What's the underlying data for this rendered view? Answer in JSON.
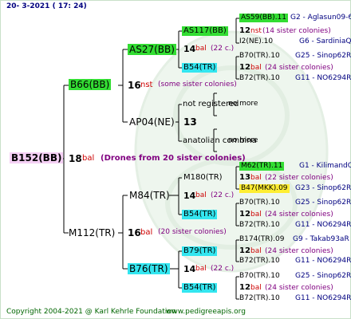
{
  "header": {
    "date": "20-  3-2021 ( 17: 24)"
  },
  "footer": {
    "copyright": "Copyright 2004-2021 @ Karl Kehrle Foundation",
    "site": "www.pedigreeapis.org"
  },
  "gen1": {
    "name": "B152(BB)",
    "num": "18",
    "bal": "bal",
    "note": "(Drones from 20 sister colonies)"
  },
  "gen2": {
    "top": {
      "name": "B66(BB)",
      "num": "16",
      "nst": "nst",
      "note": "(some sister colonies)"
    },
    "bottom": {
      "name": "M112(TR)",
      "num": "16",
      "bal": "bal",
      "note": "(20 sister colonies)"
    }
  },
  "gen3": {
    "a": {
      "name": "AS27(BB)",
      "num": "14",
      "bal": "bal",
      "note": "(22 c.)"
    },
    "b": {
      "name": "AP04(NE)",
      "num": "13"
    },
    "c": {
      "name": "M84(TR)",
      "num": "14",
      "bal": "bal",
      "note": "(22 c.)"
    },
    "d": {
      "name": "B76(TR)",
      "num": "14",
      "bal": "bal",
      "note": "(22 c.)"
    }
  },
  "gen4": {
    "a1": {
      "name": "AS117(BB)",
      "num": "12",
      "nst": "nst",
      "note": "(14 sister colonies)"
    },
    "a2": {
      "name": "B54(TR)",
      "num": "12",
      "bal": "bal",
      "note": "(24 sister colonies)"
    },
    "b1": {
      "name": "not registered"
    },
    "b2": {
      "name": "anatolian combina"
    },
    "c1": {
      "name": "M180(TR)",
      "num": "13",
      "bal": "bal",
      "note": "(22 sister colonies)"
    },
    "c2": {
      "name": "B54(TR)",
      "num": "12",
      "bal": "bal",
      "note": "(24 sister colonies)"
    },
    "d1": {
      "name": "B79(TR)",
      "num": "12",
      "bal": "bal",
      "note": "(24 sister colonies)"
    },
    "d2": {
      "name": "B54(TR)",
      "num": "12",
      "bal": "bal",
      "note": "(24 sister colonies)"
    }
  },
  "gen5": [
    {
      "name": "AS59(BB).11",
      "info": "G2 - Aglasun09-6"
    },
    {
      "name": "I2(NE).10",
      "info": "G6 - SardiniaQ"
    },
    {
      "name": "B70(TR).10",
      "info": "G25 - Sinop62R"
    },
    {
      "name": "B72(TR).10",
      "info": "G11 - NO6294R"
    },
    {
      "name": "no more"
    },
    {
      "name": "no more"
    },
    {
      "name": "M62(TR).11",
      "info": "G1 - KilimandQ"
    },
    {
      "name": "B47(MKK).09",
      "info": "G23 - Sinop62R"
    },
    {
      "name": "B70(TR).10",
      "info": "G25 - Sinop62R"
    },
    {
      "name": "B72(TR).10",
      "info": "G11 - NO6294R"
    },
    {
      "name": "B174(TR).09",
      "info": "G9 - Takab93aR"
    },
    {
      "name": "B72(TR).10",
      "info": "G11 - NO6294R"
    },
    {
      "name": "B70(TR).10",
      "info": "G25 - Sinop62R"
    },
    {
      "name": "B72(TR).10",
      "info": "G11 - NO6294R"
    }
  ]
}
